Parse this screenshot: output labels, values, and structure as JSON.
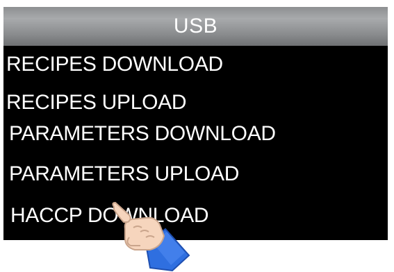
{
  "header": {
    "title": "USB"
  },
  "menu": {
    "items": [
      {
        "label": "RECIPES DOWNLOAD"
      },
      {
        "label": "RECIPES UPLOAD"
      },
      {
        "label": "PARAMETERS DOWNLOAD"
      },
      {
        "label": "PARAMETERS UPLOAD"
      },
      {
        "label": "HACCP DOWNLOAD"
      }
    ]
  },
  "overlay": {
    "icon": "pointing-hand-icon"
  },
  "colors": {
    "screen_bg": "#000000",
    "text": "#ffffff",
    "header_bg": "#9a9c9e",
    "cuff": "#2f6fe0",
    "skin": "#f6d5bd"
  }
}
